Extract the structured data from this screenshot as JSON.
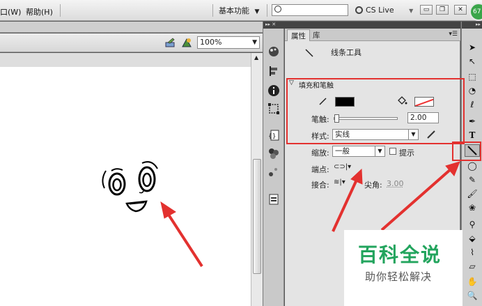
{
  "menubar": {
    "items": [
      "口(W)",
      "帮助(H)"
    ],
    "workspace": "基本功能",
    "search_placeholder": "",
    "cs_live": "CS Live",
    "badge": "67"
  },
  "stage": {
    "zoom": "100%"
  },
  "panel": {
    "tabs": [
      "属性",
      "库"
    ],
    "tool_name": "线条工具",
    "section_title": "填充和笔触",
    "stroke_label": "笔触:",
    "stroke_value": "2.00",
    "style_label": "样式:",
    "style_value": "实线",
    "scale_label": "缩放:",
    "scale_value": "一般",
    "hint_label": "提示",
    "cap_label": "端点:",
    "join_label": "接合:",
    "miter_label": "尖角:",
    "miter_value": "3.00"
  },
  "colors": {
    "stroke": "#000000",
    "highlight": "#e3312f",
    "brand_green": "#22a45d"
  },
  "watermark": {
    "title": "百科全说",
    "subtitle": "助你轻松解决"
  }
}
